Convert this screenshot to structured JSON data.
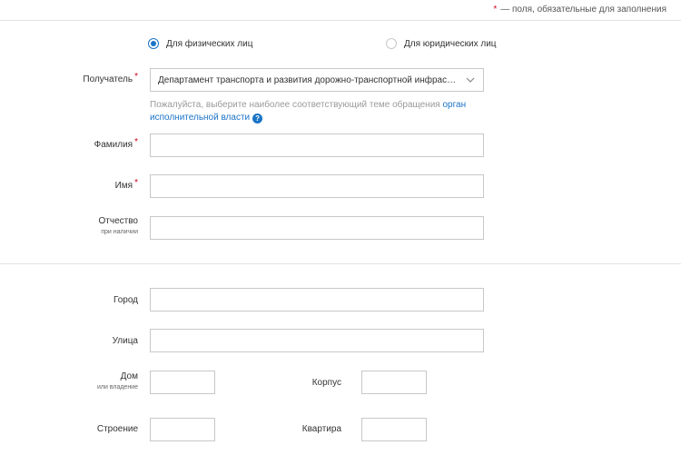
{
  "required_note": {
    "star": "*",
    "text": "— поля, обязательные для заполнения"
  },
  "person_type": {
    "options": [
      {
        "label": "Для физических лиц",
        "checked": true
      },
      {
        "label": "Для юридических лиц",
        "checked": false
      }
    ]
  },
  "recipient": {
    "label": "Получатель",
    "required_mark": "*",
    "value": "Департамент транспорта и развития дорожно-транспортной инфраструктуры города Москвы",
    "hint_text": "Пожалуйста, выберите наиболее соответствующий теме обращения ",
    "hint_link": "орган исполнительной власти",
    "help_icon_glyph": "?"
  },
  "personal": {
    "last_name": {
      "label": "Фамилия",
      "required_mark": "*",
      "value": ""
    },
    "first_name": {
      "label": "Имя",
      "required_mark": "*",
      "value": ""
    },
    "patronymic": {
      "label": "Отчество",
      "sublabel": "при наличии",
      "value": ""
    }
  },
  "address": {
    "city": {
      "label": "Город",
      "value": ""
    },
    "street": {
      "label": "Улица",
      "value": ""
    },
    "house": {
      "label": "Дом",
      "sublabel": "или владение",
      "value": ""
    },
    "building": {
      "label": "Корпус",
      "value": ""
    },
    "structure": {
      "label": "Строение",
      "value": ""
    },
    "apartment": {
      "label": "Квартира",
      "value": ""
    }
  },
  "colors": {
    "accent": "#1a73c7",
    "required": "#d0021b",
    "border": "#c8c8c8",
    "hint": "#9a9a9a"
  }
}
